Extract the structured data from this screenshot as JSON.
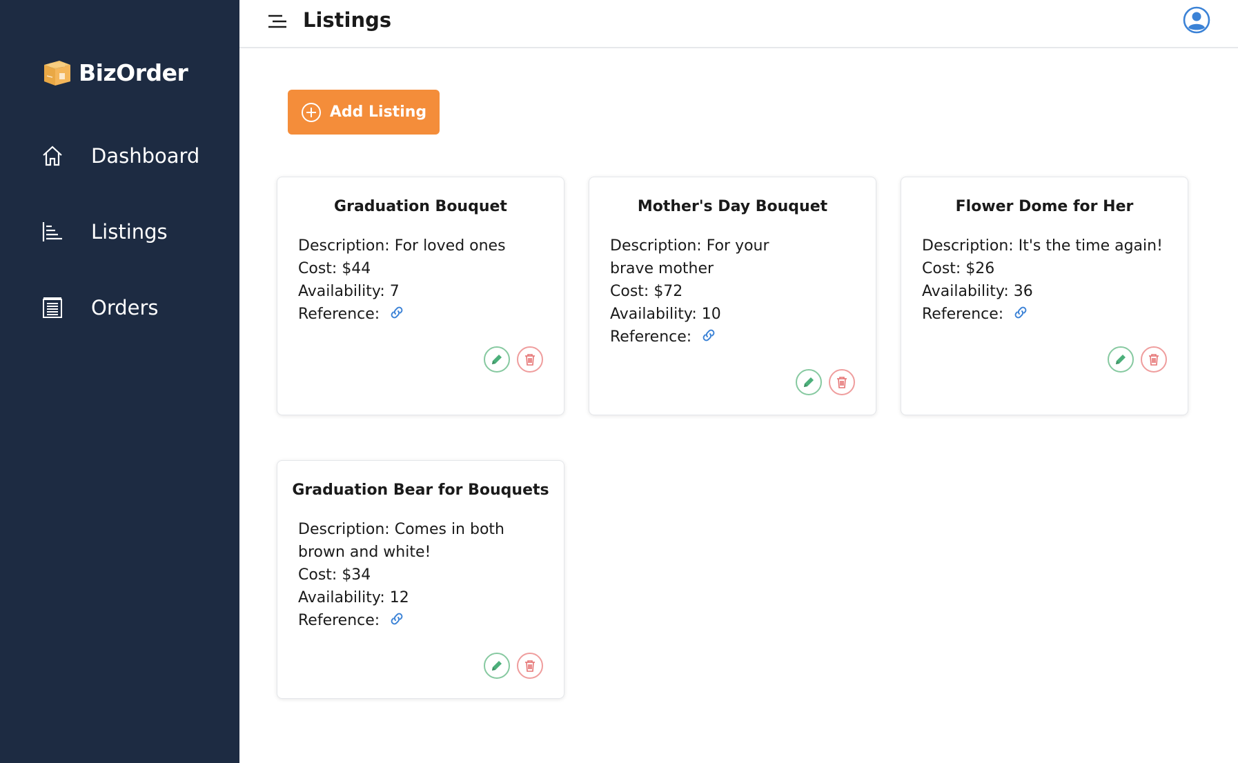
{
  "brand": {
    "name": "BizOrder"
  },
  "sidebar": {
    "items": [
      {
        "label": "Dashboard",
        "icon": "home-icon"
      },
      {
        "label": "Listings",
        "icon": "listings-icon"
      },
      {
        "label": "Orders",
        "icon": "orders-icon"
      }
    ]
  },
  "header": {
    "title": "Listings"
  },
  "toolbar": {
    "add_label": "Add Listing"
  },
  "listings": [
    {
      "title": "Graduation Bouquet",
      "description": "Description: For loved ones",
      "cost": "Cost: $44",
      "availability": "Availability: 7",
      "reference": "Reference:"
    },
    {
      "title": "Mother's Day Bouquet",
      "description": "Description: For your brave mother",
      "cost": "Cost: $72",
      "availability": "Availability: 10",
      "reference": "Reference:"
    },
    {
      "title": "Flower Dome for Her",
      "description": "Description: It's the time again!",
      "cost": "Cost: $26",
      "availability": "Availability: 36",
      "reference": "Reference:"
    },
    {
      "title": "Graduation Bear for Bouquets",
      "description": "Description: Comes in both brown and white!",
      "cost": "Cost: $34",
      "availability": "Availability: 12",
      "reference": "Reference:"
    }
  ],
  "colors": {
    "sidebar_bg": "#1d2b42",
    "accent": "#f48d3a",
    "edit": "#4caf7a",
    "delete": "#e57373",
    "link": "#3b82d6"
  }
}
